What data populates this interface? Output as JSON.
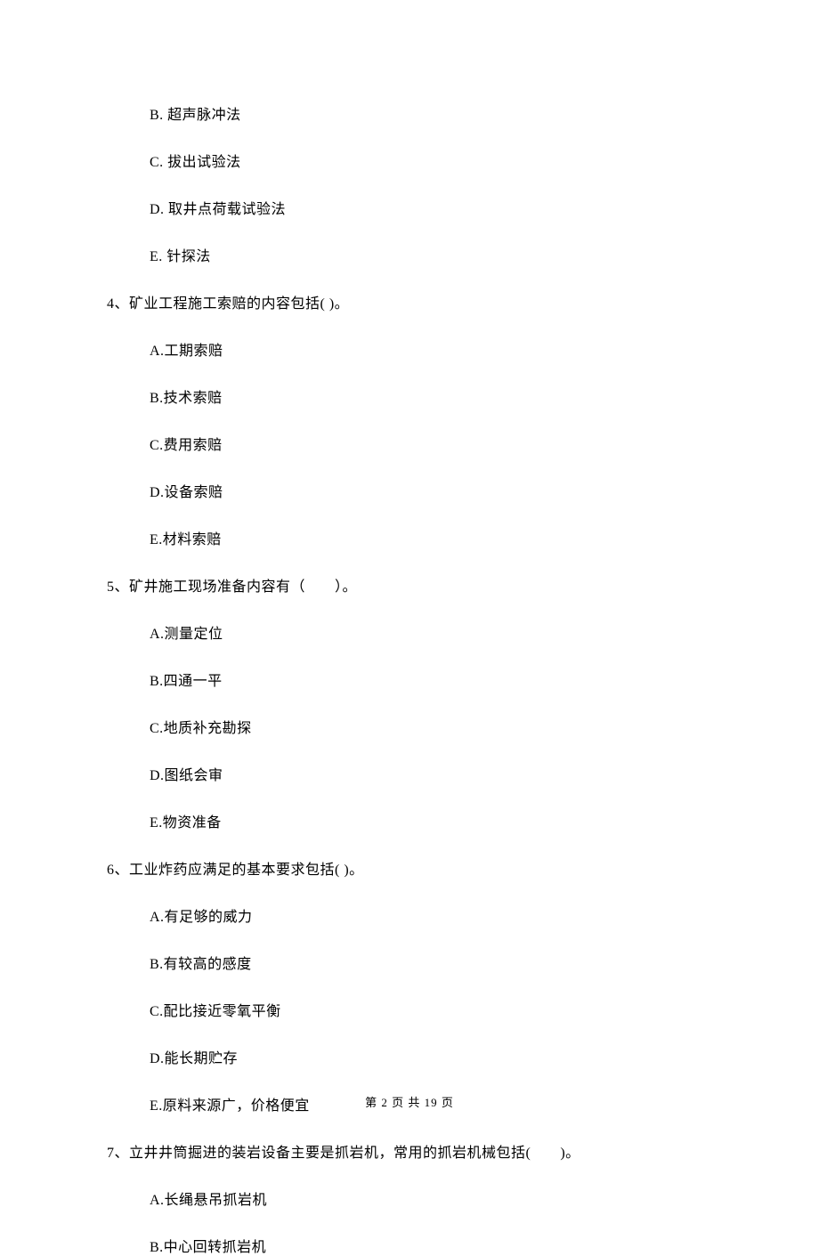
{
  "q3_options": {
    "b": "B. 超声脉冲法",
    "c": "C. 拔出试验法",
    "d": "D. 取井点荷载试验法",
    "e": "E. 针探法"
  },
  "q4": {
    "text": "4、矿业工程施工索赔的内容包括(    )。",
    "options": {
      "a": "A.工期索赔",
      "b": "B.技术索赔",
      "c": "C.费用索赔",
      "d": "D.设备索赔",
      "e": "E.材料索赔"
    }
  },
  "q5": {
    "text": "5、矿井施工现场准备内容有（　　）。",
    "options": {
      "a": "A.测量定位",
      "b": "B.四通一平",
      "c": "C.地质补充勘探",
      "d": "D.图纸会审",
      "e": "E.物资准备"
    }
  },
  "q6": {
    "text": "6、工业炸药应满足的基本要求包括(    )。",
    "options": {
      "a": "A.有足够的威力",
      "b": "B.有较高的感度",
      "c": "C.配比接近零氧平衡",
      "d": "D.能长期贮存",
      "e": "E.原料来源广，价格便宜"
    }
  },
  "q7": {
    "text": "7、立井井筒掘进的装岩设备主要是抓岩机，常用的抓岩机械包括(　　)。",
    "options": {
      "a": "A.长绳悬吊抓岩机",
      "b": "B.中心回转抓岩机"
    }
  },
  "footer": "第 2 页 共 19 页"
}
